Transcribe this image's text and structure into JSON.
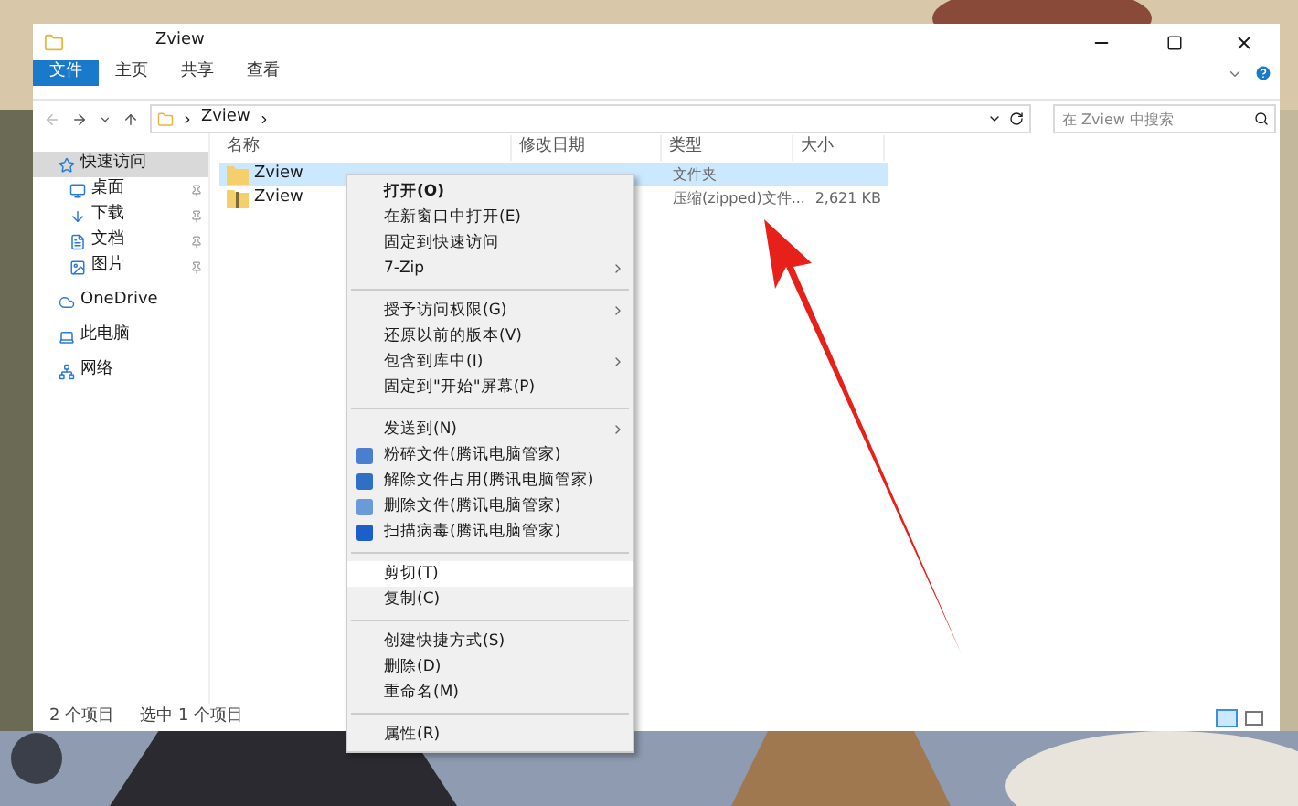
{
  "window": {
    "title": "Zview"
  },
  "ribbon_tabs": [
    {
      "label": "文件",
      "selected": true
    },
    {
      "label": "主页",
      "selected": false
    },
    {
      "label": "共享",
      "selected": false
    },
    {
      "label": "查看",
      "selected": false
    }
  ],
  "address": {
    "path": "Zview"
  },
  "search": {
    "placeholder": "在 Zview 中搜索"
  },
  "sidebar": {
    "items": [
      {
        "label": "快速访问",
        "selected": true,
        "pinned": false
      },
      {
        "label": "桌面",
        "selected": false,
        "pinned": true
      },
      {
        "label": "下载",
        "selected": false,
        "pinned": true
      },
      {
        "label": "文档",
        "selected": false,
        "pinned": true
      },
      {
        "label": "图片",
        "selected": false,
        "pinned": true
      },
      {
        "label": "OneDrive",
        "selected": false,
        "pinned": false
      },
      {
        "label": "此电脑",
        "selected": false,
        "pinned": false
      },
      {
        "label": "网络",
        "selected": false,
        "pinned": false
      }
    ]
  },
  "table": {
    "columns": [
      "名称",
      "修改日期",
      "类型",
      "大小"
    ],
    "rows": [
      {
        "name": "Zview",
        "kind": "folder",
        "type": "文件夹",
        "size": "",
        "selected": true
      },
      {
        "name": "Zview",
        "kind": "zip",
        "type": "压缩(zipped)文件...",
        "size": "2,621 KB",
        "selected": false
      }
    ]
  },
  "context_menu": [
    {
      "kind": "item",
      "label": "打开(O)",
      "bold": true,
      "submenu": false,
      "selected": false
    },
    {
      "kind": "item",
      "label": "在新窗口中打开(E)",
      "bold": false,
      "submenu": false,
      "selected": false
    },
    {
      "kind": "item",
      "label": "固定到快速访问",
      "bold": false,
      "submenu": false,
      "selected": false
    },
    {
      "kind": "item",
      "label": "7-Zip",
      "bold": false,
      "submenu": true,
      "selected": false
    },
    {
      "kind": "separator"
    },
    {
      "kind": "item",
      "label": "授予访问权限(G)",
      "bold": false,
      "submenu": true,
      "selected": false
    },
    {
      "kind": "item",
      "label": "还原以前的版本(V)",
      "bold": false,
      "submenu": false,
      "selected": false
    },
    {
      "kind": "item",
      "label": "包含到库中(I)",
      "bold": false,
      "submenu": true,
      "selected": false
    },
    {
      "kind": "item",
      "label": "固定到\"开始\"屏幕(P)",
      "bold": false,
      "submenu": false,
      "selected": false
    },
    {
      "kind": "separator"
    },
    {
      "kind": "item",
      "label": "发送到(N)",
      "bold": false,
      "submenu": true,
      "selected": false
    },
    {
      "kind": "tool",
      "label": "粉碎文件(腾讯电脑管家)",
      "color": "#4a7fd0",
      "bold": false,
      "submenu": false,
      "selected": false
    },
    {
      "kind": "tool",
      "label": "解除文件占用(腾讯电脑管家)",
      "color": "#2f6fc4",
      "bold": false,
      "submenu": false,
      "selected": false
    },
    {
      "kind": "tool",
      "label": "删除文件(腾讯电脑管家)",
      "color": "#6a9ad8",
      "bold": false,
      "submenu": false,
      "selected": false
    },
    {
      "kind": "tool",
      "label": "扫描病毒(腾讯电脑管家)",
      "color": "#1d5fc9",
      "bold": false,
      "submenu": false,
      "selected": false
    },
    {
      "kind": "separator"
    },
    {
      "kind": "item",
      "label": "剪切(T)",
      "bold": false,
      "submenu": false,
      "selected": true
    },
    {
      "kind": "item",
      "label": "复制(C)",
      "bold": false,
      "submenu": false,
      "selected": false
    },
    {
      "kind": "separator"
    },
    {
      "kind": "item",
      "label": "创建快捷方式(S)",
      "bold": false,
      "submenu": false,
      "selected": false
    },
    {
      "kind": "item",
      "label": "删除(D)",
      "bold": false,
      "submenu": false,
      "selected": false
    },
    {
      "kind": "item",
      "label": "重命名(M)",
      "bold": false,
      "submenu": false,
      "selected": false
    },
    {
      "kind": "separator"
    },
    {
      "kind": "item",
      "label": "属性(R)",
      "bold": false,
      "submenu": false,
      "selected": false
    }
  ],
  "status_bar": {
    "count": "2 个项目",
    "selection": "选中 1 个项目"
  }
}
